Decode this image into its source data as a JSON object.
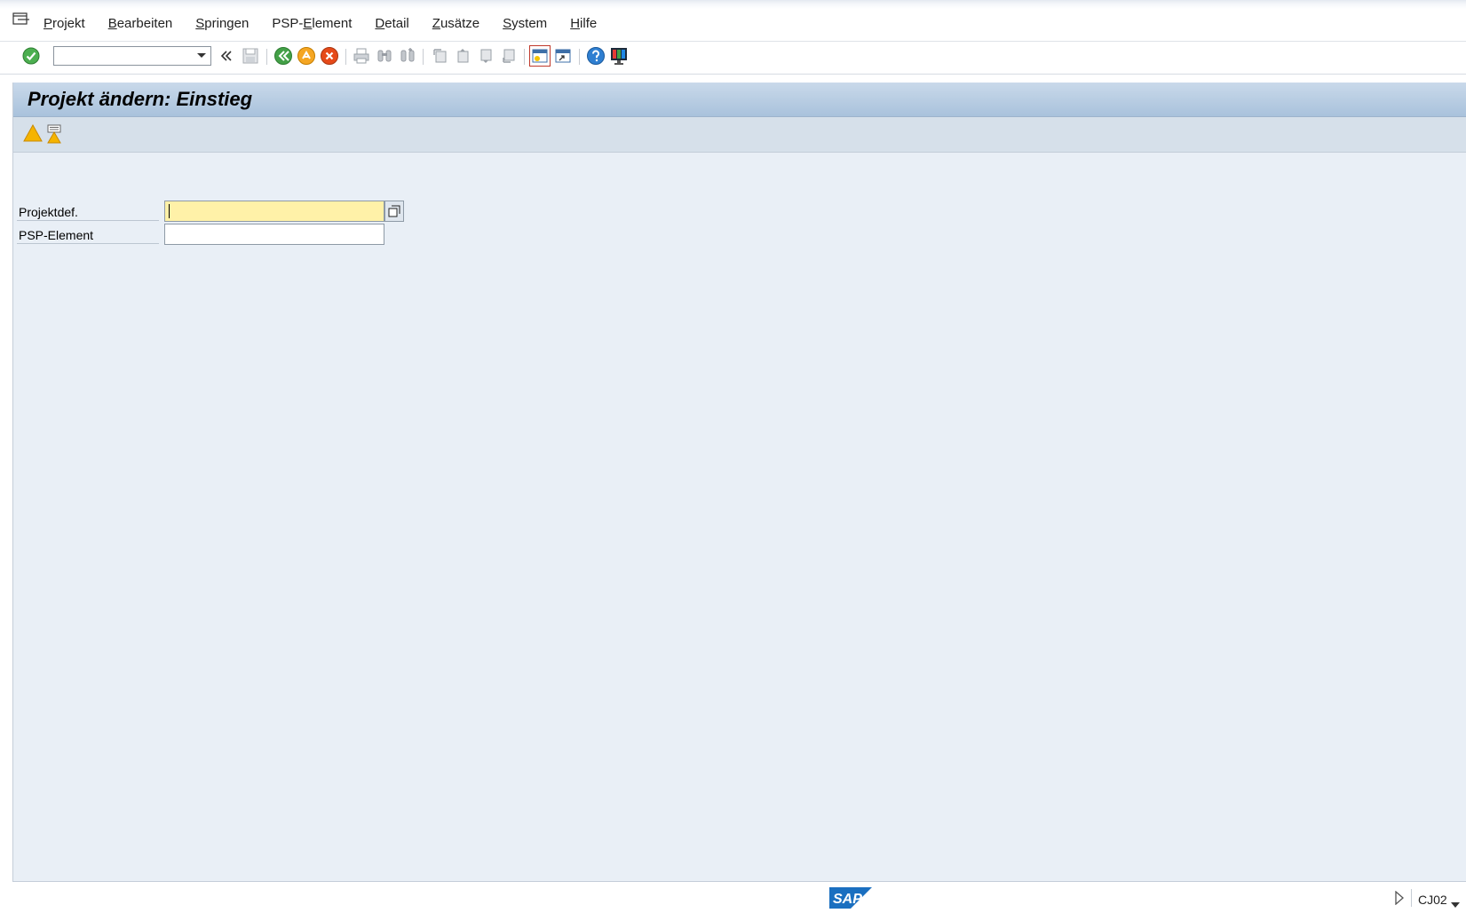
{
  "menu": {
    "items": [
      {
        "pre": "",
        "ul": "P",
        "post": "rojekt"
      },
      {
        "pre": "",
        "ul": "B",
        "post": "earbeiten"
      },
      {
        "pre": "",
        "ul": "S",
        "post": "pringen"
      },
      {
        "pre": "PSP-",
        "ul": "E",
        "post": "lement"
      },
      {
        "pre": "",
        "ul": "D",
        "post": "etail"
      },
      {
        "pre": "",
        "ul": "Z",
        "post": "usätze"
      },
      {
        "pre": "",
        "ul": "S",
        "post": "ystem"
      },
      {
        "pre": "",
        "ul": "H",
        "post": "ilfe"
      }
    ]
  },
  "toolbar": {
    "command_field_value": ""
  },
  "screen": {
    "title": "Projekt ändern: Einstieg"
  },
  "form": {
    "projektdef": {
      "label": "Projektdef.",
      "value": ""
    },
    "psp_element": {
      "label": "PSP-Element",
      "value": ""
    }
  },
  "status": {
    "logo_text": "SAP",
    "transaction": "CJ02"
  },
  "colors": {
    "required_field": "#fff1a8",
    "title_bar": "#b8cde3",
    "screen_bg": "#e9eff6",
    "accent_blue": "#1a6fc0"
  }
}
